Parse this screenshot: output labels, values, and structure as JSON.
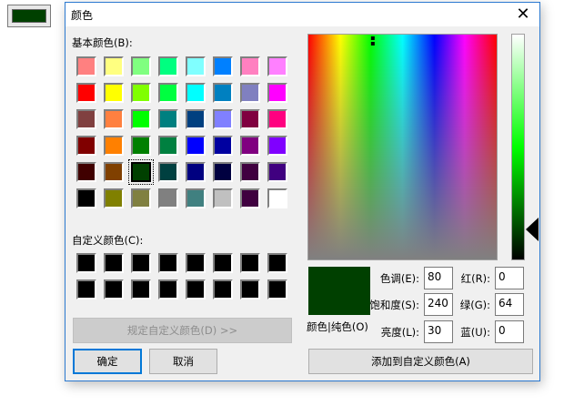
{
  "preview_swatch": {
    "color": "#004000"
  },
  "dialog": {
    "title": "颜色",
    "close_icon": "close-icon",
    "basic_label": "基本颜色(B):",
    "basic_colors": [
      [
        "#FF8080",
        "#FFFF80",
        "#80FF80",
        "#00FF80",
        "#80FFFF",
        "#0080FF",
        "#FF80C0",
        "#FF80FF"
      ],
      [
        "#FF0000",
        "#FFFF00",
        "#80FF00",
        "#00FF40",
        "#00FFFF",
        "#0080C0",
        "#8080C0",
        "#FF00FF"
      ],
      [
        "#804040",
        "#FF8040",
        "#00FF00",
        "#008080",
        "#004080",
        "#8080FF",
        "#800040",
        "#FF0080"
      ],
      [
        "#800000",
        "#FF8000",
        "#008000",
        "#008040",
        "#0000FF",
        "#0000A0",
        "#800080",
        "#8000FF"
      ],
      [
        "#400000",
        "#804000",
        "#004000",
        "#004040",
        "#000080",
        "#000040",
        "#400040",
        "#400080"
      ],
      [
        "#000000",
        "#808000",
        "#808040",
        "#808080",
        "#408080",
        "#C0C0C0",
        "#400040",
        "#FFFFFF"
      ]
    ],
    "selected_basic": [
      4,
      2
    ],
    "custom_label": "自定义颜色(C):",
    "custom_colors": [
      [
        "#000000",
        "#000000",
        "#000000",
        "#000000",
        "#000000",
        "#000000",
        "#000000",
        "#000000"
      ],
      [
        "#000000",
        "#000000",
        "#000000",
        "#000000",
        "#000000",
        "#000000",
        "#000000",
        "#000000"
      ]
    ],
    "define_button": "规定自定义颜色(D) >>",
    "ok_button": "确定",
    "cancel_button": "取消",
    "color_solid_label": "颜色|纯色(O)",
    "current_color": "#004000",
    "hue_label": "色调(E):",
    "hue": "80",
    "sat_label": "饱和度(S):",
    "sat": "240",
    "lum_label": "亮度(L):",
    "lum": "30",
    "red_label": "红(R):",
    "red": "0",
    "green_label": "绿(G):",
    "green": "64",
    "blue_label": "蓝(U):",
    "blue": "0",
    "add_custom_button": "添加到自定义颜色(A)"
  }
}
